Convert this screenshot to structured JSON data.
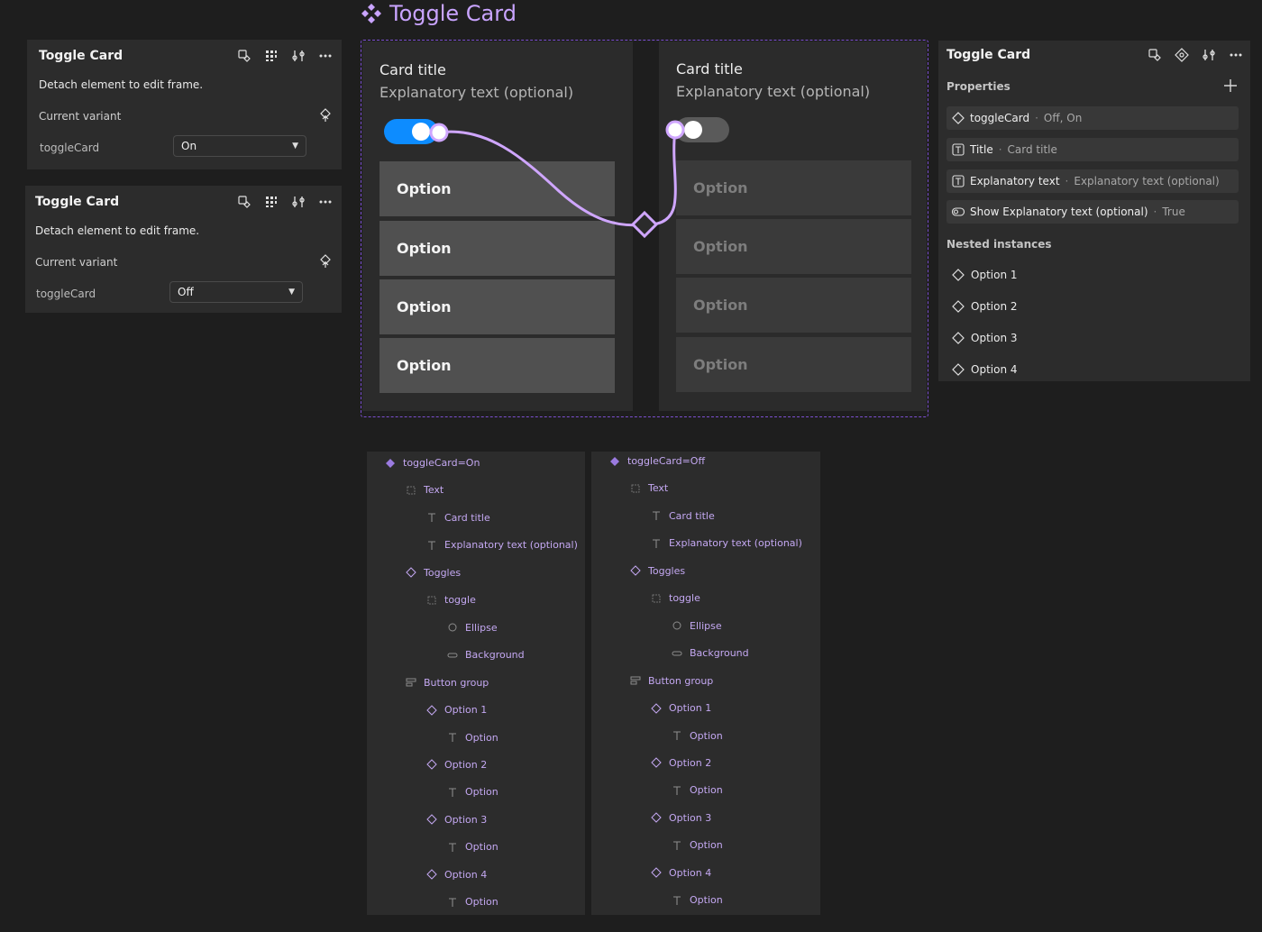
{
  "frame_title": "Toggle Card",
  "colors": {
    "accent_purple": "#c9a4ff",
    "toggle_on": "#0d8cff",
    "toggle_off": "#5a5a5a",
    "connector": "#cfa6ff"
  },
  "inspector_panels": [
    {
      "title": "Toggle Card",
      "detach_text": "Detach element to edit frame.",
      "current_variant_label": "Current variant",
      "property_label": "toggleCard",
      "property_value": "On",
      "icons": [
        "component-instance-icon",
        "grid-icon",
        "adjust-icon",
        "more-icon",
        "variant-upload-icon"
      ]
    },
    {
      "title": "Toggle Card",
      "detach_text": "Detach element to edit frame.",
      "current_variant_label": "Current variant",
      "property_label": "toggleCard",
      "property_value": "Off",
      "icons": [
        "component-instance-icon",
        "grid-icon",
        "adjust-icon",
        "more-icon",
        "variant-upload-icon"
      ]
    }
  ],
  "cards": [
    {
      "title": "Card title",
      "explanatory": "Explanatory text (optional)",
      "toggle_state": "on",
      "options": [
        "Option",
        "Option",
        "Option",
        "Option"
      ]
    },
    {
      "title": "Card title",
      "explanatory": "Explanatory text (optional)",
      "toggle_state": "off",
      "options": [
        "Option",
        "Option",
        "Option",
        "Option"
      ]
    }
  ],
  "right_panel": {
    "title": "Toggle Card",
    "properties_label": "Properties",
    "properties": [
      {
        "icon": "variant-icon",
        "name": "toggleCard",
        "sep": "·",
        "value": "Off, On"
      },
      {
        "icon": "text-property-icon",
        "name": "Title",
        "sep": "·",
        "value": "Card title"
      },
      {
        "icon": "text-property-icon",
        "name": "Explanatory text",
        "sep": "·",
        "value": "Explanatory text (optional)"
      },
      {
        "icon": "boolean-icon",
        "name": "Show Explanatory text (optional)",
        "sep": "·",
        "value": "True"
      }
    ],
    "nested_label": "Nested instances",
    "nested": [
      "Option 1",
      "Option 2",
      "Option 3",
      "Option 4"
    ]
  },
  "layers": [
    {
      "rows": [
        {
          "icon": "component-set-icon",
          "label": "toggleCard=On",
          "depth": 0
        },
        {
          "icon": "frame-icon",
          "label": "Text",
          "depth": 1
        },
        {
          "icon": "text-icon",
          "label": "Card title",
          "depth": 2
        },
        {
          "icon": "text-icon",
          "label": "Explanatory text (optional)",
          "depth": 2
        },
        {
          "icon": "instance-icon",
          "label": "Toggles",
          "depth": 1
        },
        {
          "icon": "frame-icon",
          "label": "toggle",
          "depth": 2
        },
        {
          "icon": "ellipse-icon",
          "label": "Ellipse",
          "depth": 3
        },
        {
          "icon": "rect-icon",
          "label": "Background",
          "depth": 3
        },
        {
          "icon": "autolayout-icon",
          "label": "Button group",
          "depth": 1
        },
        {
          "icon": "instance-icon",
          "label": "Option 1",
          "depth": 2
        },
        {
          "icon": "text-icon",
          "label": "Option",
          "depth": 3
        },
        {
          "icon": "instance-icon",
          "label": "Option 2",
          "depth": 2
        },
        {
          "icon": "text-icon",
          "label": "Option",
          "depth": 3
        },
        {
          "icon": "instance-icon",
          "label": "Option 3",
          "depth": 2
        },
        {
          "icon": "text-icon",
          "label": "Option",
          "depth": 3
        },
        {
          "icon": "instance-icon",
          "label": "Option 4",
          "depth": 2
        },
        {
          "icon": "text-icon",
          "label": "Option",
          "depth": 3
        }
      ]
    },
    {
      "rows": [
        {
          "icon": "component-set-icon",
          "label": "toggleCard=Off",
          "depth": 0
        },
        {
          "icon": "frame-icon",
          "label": "Text",
          "depth": 1
        },
        {
          "icon": "text-icon",
          "label": "Card title",
          "depth": 2
        },
        {
          "icon": "text-icon",
          "label": "Explanatory text (optional)",
          "depth": 2
        },
        {
          "icon": "instance-icon",
          "label": "Toggles",
          "depth": 1
        },
        {
          "icon": "frame-icon",
          "label": "toggle",
          "depth": 2
        },
        {
          "icon": "ellipse-icon",
          "label": "Ellipse",
          "depth": 3
        },
        {
          "icon": "rect-icon",
          "label": "Background",
          "depth": 3
        },
        {
          "icon": "autolayout-icon",
          "label": "Button group",
          "depth": 1
        },
        {
          "icon": "instance-icon",
          "label": "Option 1",
          "depth": 2
        },
        {
          "icon": "text-icon",
          "label": "Option",
          "depth": 3
        },
        {
          "icon": "instance-icon",
          "label": "Option 2",
          "depth": 2
        },
        {
          "icon": "text-icon",
          "label": "Option",
          "depth": 3
        },
        {
          "icon": "instance-icon",
          "label": "Option 3",
          "depth": 2
        },
        {
          "icon": "text-icon",
          "label": "Option",
          "depth": 3
        },
        {
          "icon": "instance-icon",
          "label": "Option 4",
          "depth": 2
        },
        {
          "icon": "text-icon",
          "label": "Option",
          "depth": 3
        }
      ]
    }
  ]
}
